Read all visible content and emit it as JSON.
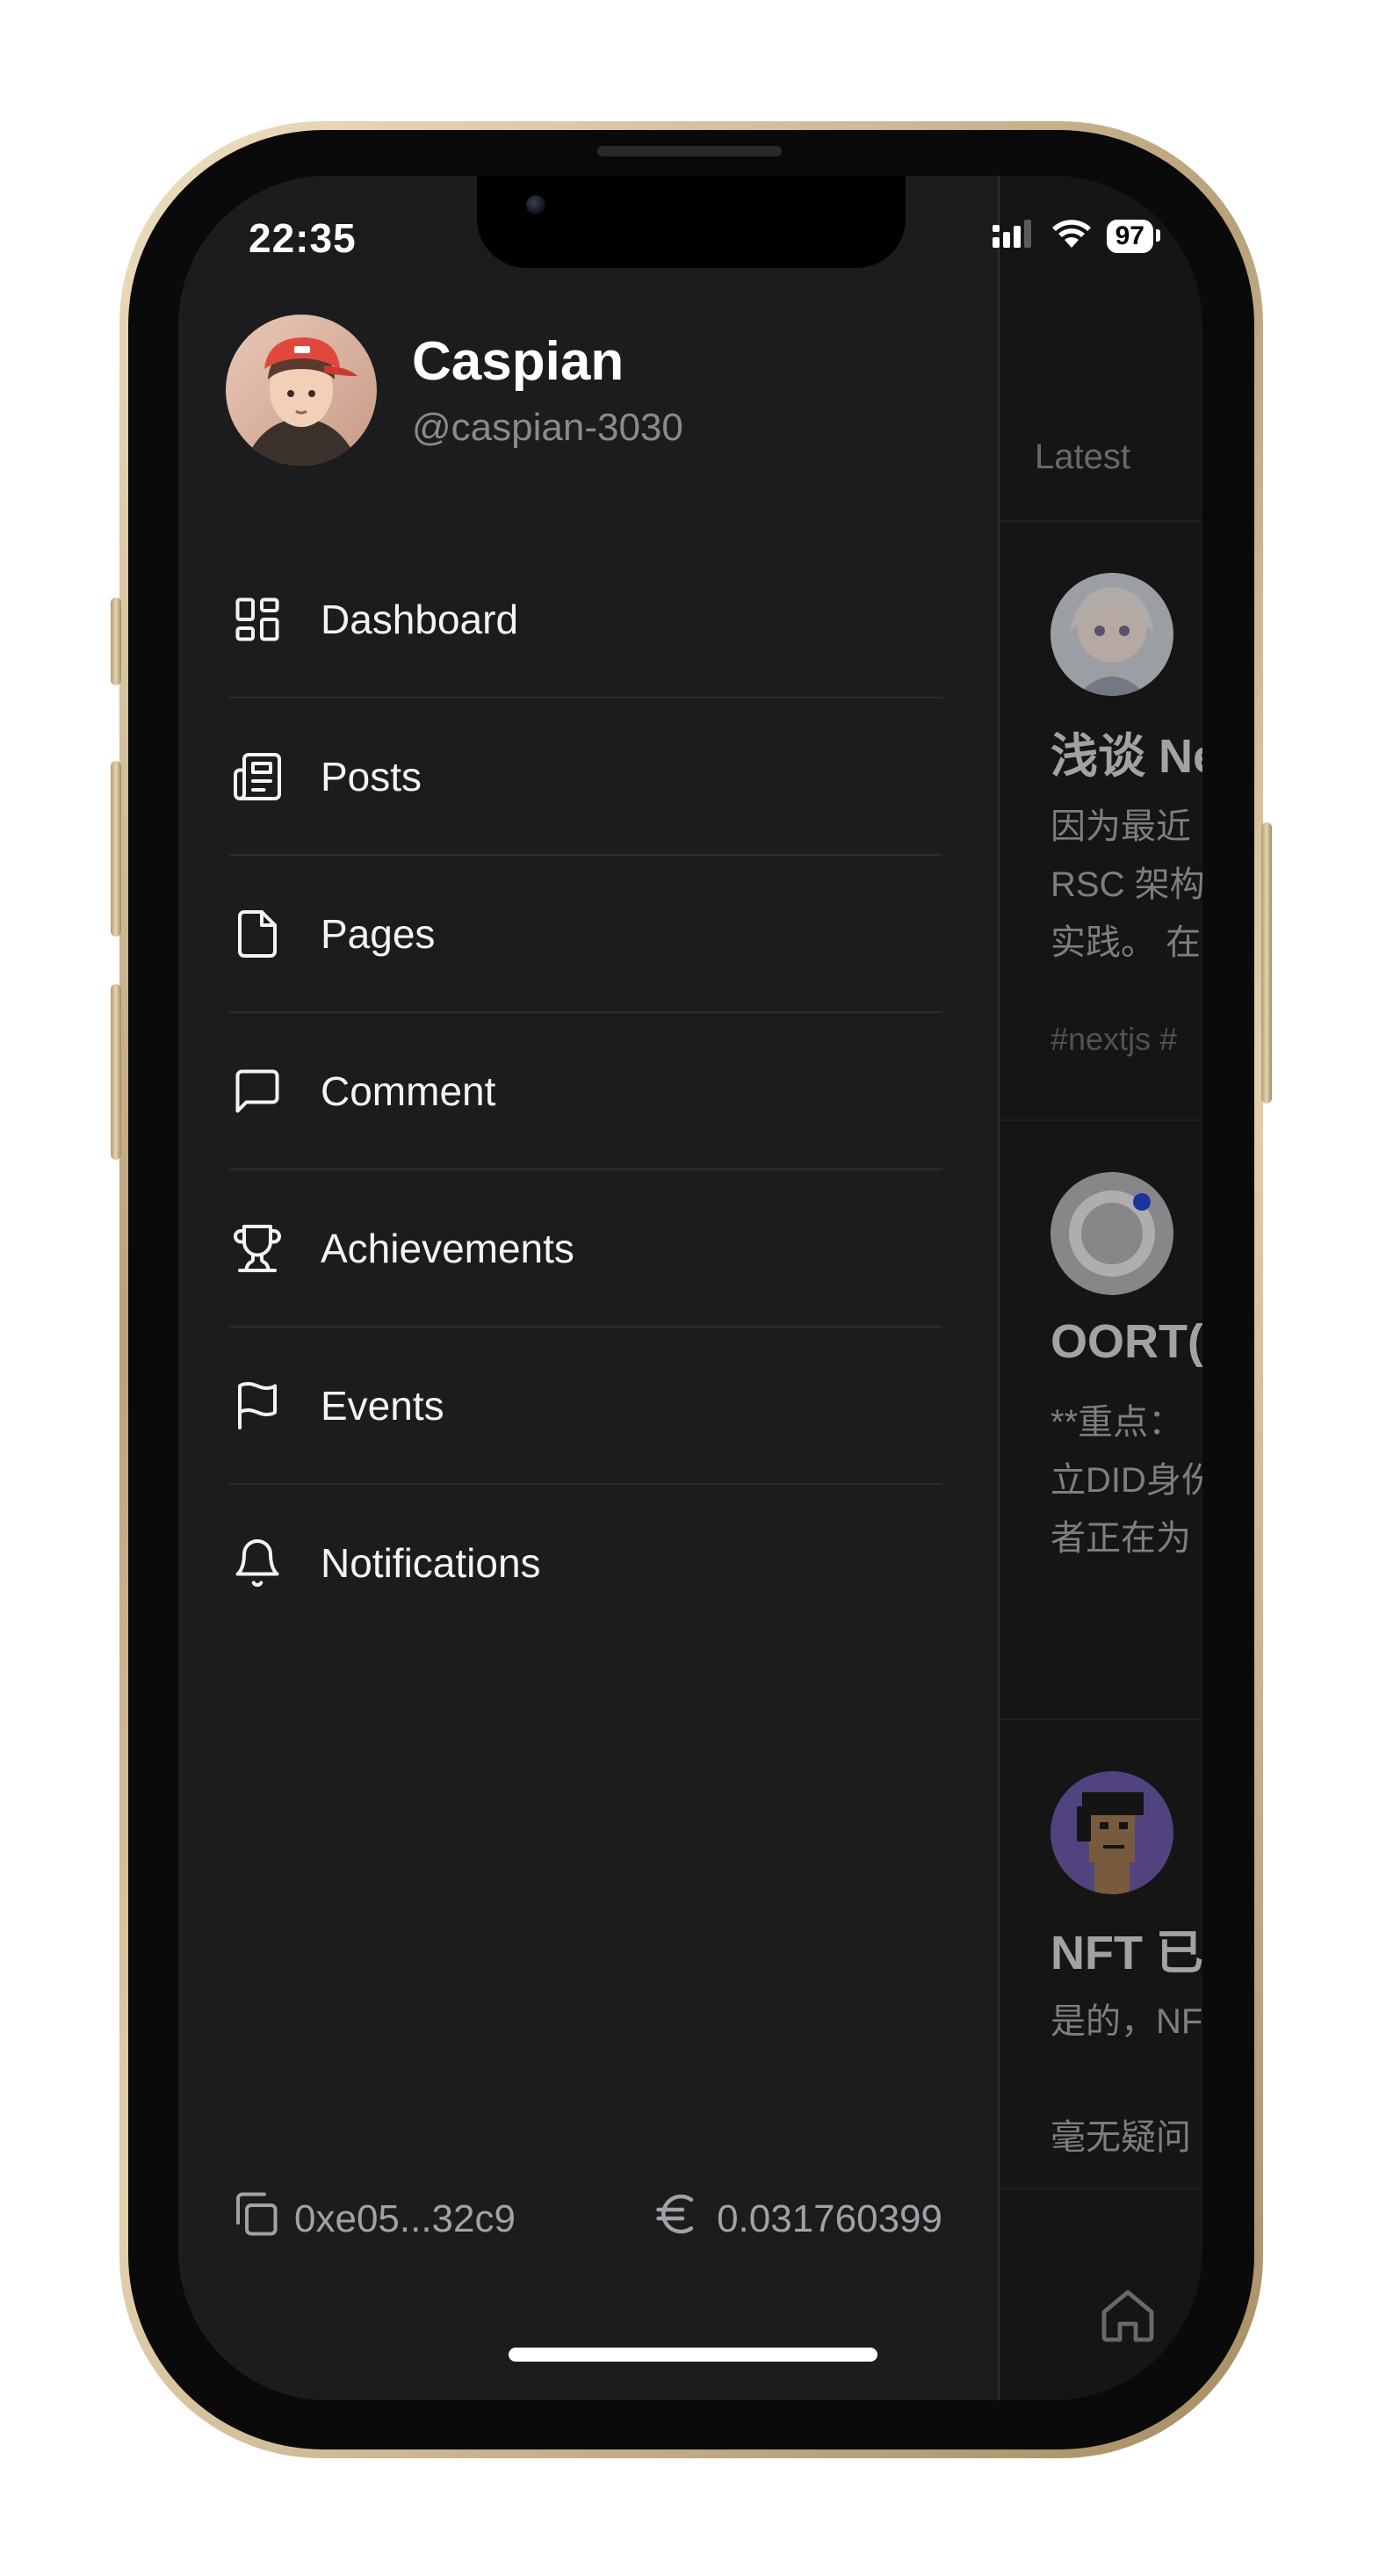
{
  "status_bar": {
    "time": "22:35",
    "battery": "97"
  },
  "profile": {
    "name": "Caspian",
    "handle": "@caspian-3030"
  },
  "menu": [
    {
      "label": "Dashboard",
      "icon": "dashboard-icon"
    },
    {
      "label": "Posts",
      "icon": "newspaper-icon"
    },
    {
      "label": "Pages",
      "icon": "file-icon"
    },
    {
      "label": "Comment",
      "icon": "message-square-icon"
    },
    {
      "label": "Achievements",
      "icon": "trophy-icon"
    },
    {
      "label": "Events",
      "icon": "flag-icon"
    },
    {
      "label": "Notifications",
      "icon": "bell-icon"
    }
  ],
  "footer": {
    "address": "0xe05...32c9",
    "balance": "0.031760399"
  },
  "feed": {
    "tab": "Latest",
    "posts": [
      {
        "title": "浅谈 Ne",
        "lines": [
          "因为最近",
          "RSC 架构",
          "实践。 在"
        ],
        "tags": "#nextjs  #"
      },
      {
        "title": "OORT(",
        "lines": [
          "**重点：",
          "立DID身份",
          "者正在为"
        ],
        "tags": ""
      },
      {
        "title": "NFT 已",
        "lines": [
          "是的，NF",
          "",
          "毫无疑问"
        ],
        "tags": ""
      }
    ]
  },
  "colors": {
    "drawer_bg": "#1c1c1e",
    "text_primary": "#f4f4f5",
    "text_secondary": "#8a8a8e",
    "divider": "#2c2c2f"
  }
}
